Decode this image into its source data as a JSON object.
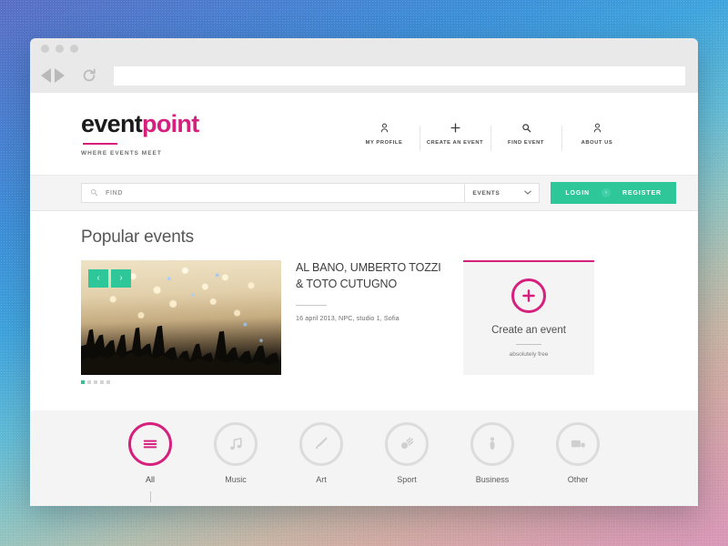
{
  "browser": {
    "window_dots": [
      "dot-1",
      "dot-2",
      "dot-3"
    ],
    "back_icon": "back-triangle-icon",
    "forward_icon": "forward-triangle-icon",
    "reload_icon": "reload-icon",
    "url_value": "",
    "url_placeholder": ""
  },
  "site": {
    "logo": {
      "part_dark": "event",
      "part_pink": "point",
      "tagline": "WHERE EVENTS MEET",
      "dark_color": "#1b1b1b",
      "pink_color": "#d6207e"
    },
    "nav": [
      {
        "label": "MY PROFILE",
        "icon": "user-icon"
      },
      {
        "label": "CREATE AN EVENT",
        "icon": "plus-icon"
      },
      {
        "label": "FIND EVENT",
        "icon": "search-icon"
      },
      {
        "label": "ABOUT US",
        "icon": "user-icon"
      }
    ],
    "search": {
      "icon": "search-icon",
      "placeholder": "FIND",
      "value": "",
      "type_selected": "EVENTS",
      "type_options": [
        "EVENTS"
      ],
      "dropdown_icon": "chevron-down-icon"
    },
    "auth": {
      "login_label": "LOGIN",
      "separator_icon": "chevron-right-icon",
      "register_label": "REGISTER",
      "accent_color": "#2ec79a"
    }
  },
  "main": {
    "section_title": "Popular events",
    "slider": {
      "prev_icon": "chevron-left-icon",
      "next_icon": "chevron-right-icon",
      "image_alt": "concert-crowd-photo",
      "dot_count": 5,
      "active_dot": 1
    },
    "featured_event": {
      "title": "AL BANO, UMBERTO TOZZI & TOTO CUTUGNO",
      "meta": "16 april 2013, NPC, studio 1, Sofia"
    },
    "create_card": {
      "icon": "plus-circle-icon",
      "title": "Create an event",
      "subtitle": "absolutely free",
      "accent_color": "#d6207e"
    }
  },
  "categories": [
    {
      "label": "All",
      "icon": "hamburger-icon",
      "active": true
    },
    {
      "label": "Music",
      "icon": "music-note-icon",
      "active": false
    },
    {
      "label": "Art",
      "icon": "paintbrush-icon",
      "active": false
    },
    {
      "label": "Sport",
      "icon": "ball-icon",
      "active": false
    },
    {
      "label": "Business",
      "icon": "person-tie-icon",
      "active": false
    },
    {
      "label": "Other",
      "icon": "screens-icon",
      "active": false
    }
  ]
}
